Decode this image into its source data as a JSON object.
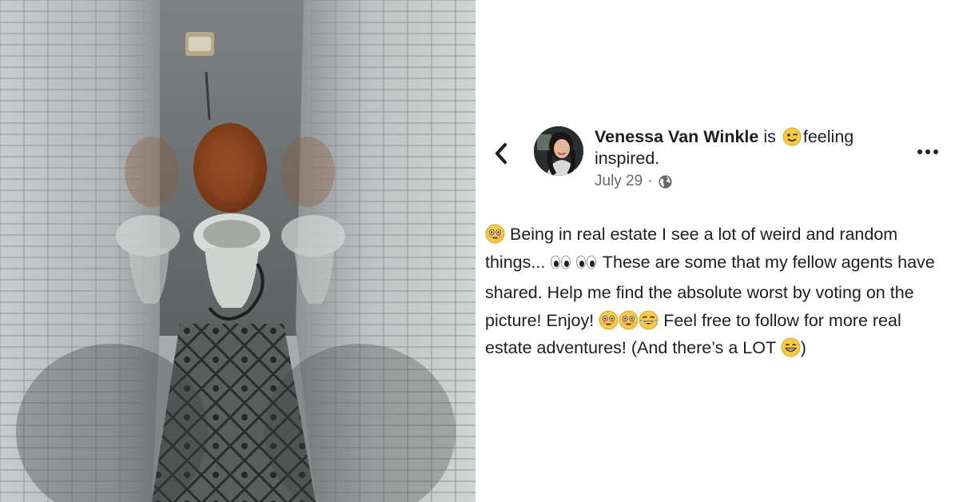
{
  "post": {
    "author": "Venessa Van Winkle",
    "is_text": "is",
    "feeling_label": "feeling",
    "feeling_word": "inspired.",
    "date": "July 29",
    "separator": "·",
    "body": {
      "seg1": "Being in real estate I see a lot of weird and random things...",
      "seg2": "These are some that my fellow agents have shared. Help me find the absolute worst by voting  on the picture!  Enjoy!",
      "seg3": "Feel free to follow for more real estate adventures! (And there’s a LOT",
      "seg4": ")"
    }
  },
  "icons": {
    "back": "chevron-left-icon",
    "more": "more-horizontal-icon",
    "privacy": "globe-icon",
    "feeling": "winking-face-emoji",
    "flushed": "flushed-face-emoji",
    "eyes": "eyes-emoji",
    "laugh": "tears-of-joy-emoji",
    "grin": "grinning-face-emoji"
  },
  "colors": {
    "text": "#1c1e21",
    "meta": "#65676b",
    "emoji_yellow": "#f7c948"
  }
}
